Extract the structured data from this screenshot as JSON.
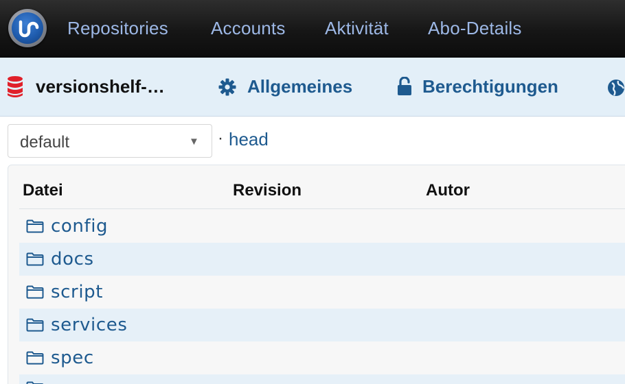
{
  "topnav": {
    "items": [
      {
        "label": "Repositories"
      },
      {
        "label": "Accounts"
      },
      {
        "label": "Aktivität"
      },
      {
        "label": "Abo-Details"
      }
    ]
  },
  "repo": {
    "name": "versionshelf-…",
    "tabs": [
      {
        "label": "Allgemeines",
        "icon": "gear-icon"
      },
      {
        "label": "Berechtigungen",
        "icon": "unlock-icon"
      }
    ]
  },
  "branch": {
    "selected": "default",
    "separator": "·",
    "head_label": "head"
  },
  "table": {
    "columns": [
      "Datei",
      "Revision",
      "Autor"
    ],
    "rows": [
      {
        "name": "config"
      },
      {
        "name": "docs"
      },
      {
        "name": "script"
      },
      {
        "name": "services"
      },
      {
        "name": "spec"
      }
    ]
  },
  "colors": {
    "topbar": "#161616",
    "nav_text": "#9db8e6",
    "link": "#1e5a8f",
    "subbar": "#e3eff8",
    "row_alt": "#e6f0f8",
    "repo_icon": "#e0202a"
  }
}
